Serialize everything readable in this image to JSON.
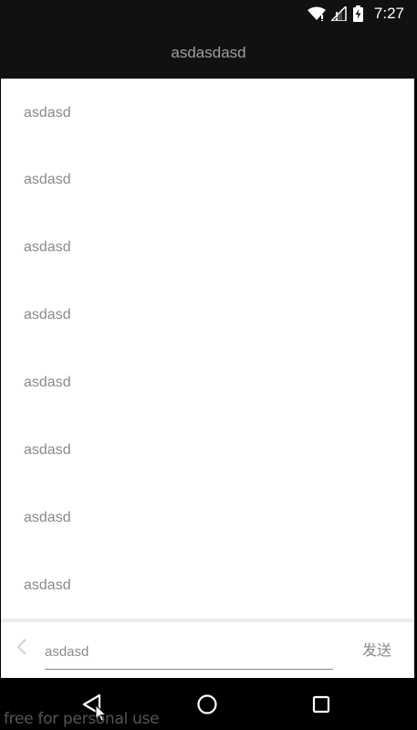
{
  "status_bar": {
    "time": "7:27",
    "icons": [
      "wifi-icon",
      "signal-icon",
      "battery-charging-icon"
    ]
  },
  "app_bar": {
    "title": "asdasdasd"
  },
  "messages": [
    {
      "text": "asdasd"
    },
    {
      "text": "asdasd"
    },
    {
      "text": "asdasd"
    },
    {
      "text": "asdasd"
    },
    {
      "text": "asdasd"
    },
    {
      "text": "asdasd"
    },
    {
      "text": "asdasd"
    },
    {
      "text": "asdasd"
    }
  ],
  "input_bar": {
    "back_icon": "chevron-left-icon",
    "input_value": "asdasd",
    "send_label": "发送"
  },
  "nav_bar": {
    "icons": [
      "back-triangle-icon",
      "home-circle-icon",
      "recents-square-icon"
    ]
  },
  "watermark": "free for personal use",
  "colors": {
    "bar_background": "#111111",
    "content_background": "#ffffff",
    "text_gray": "#8a8a8a",
    "title_gray": "#9e9e9e"
  }
}
